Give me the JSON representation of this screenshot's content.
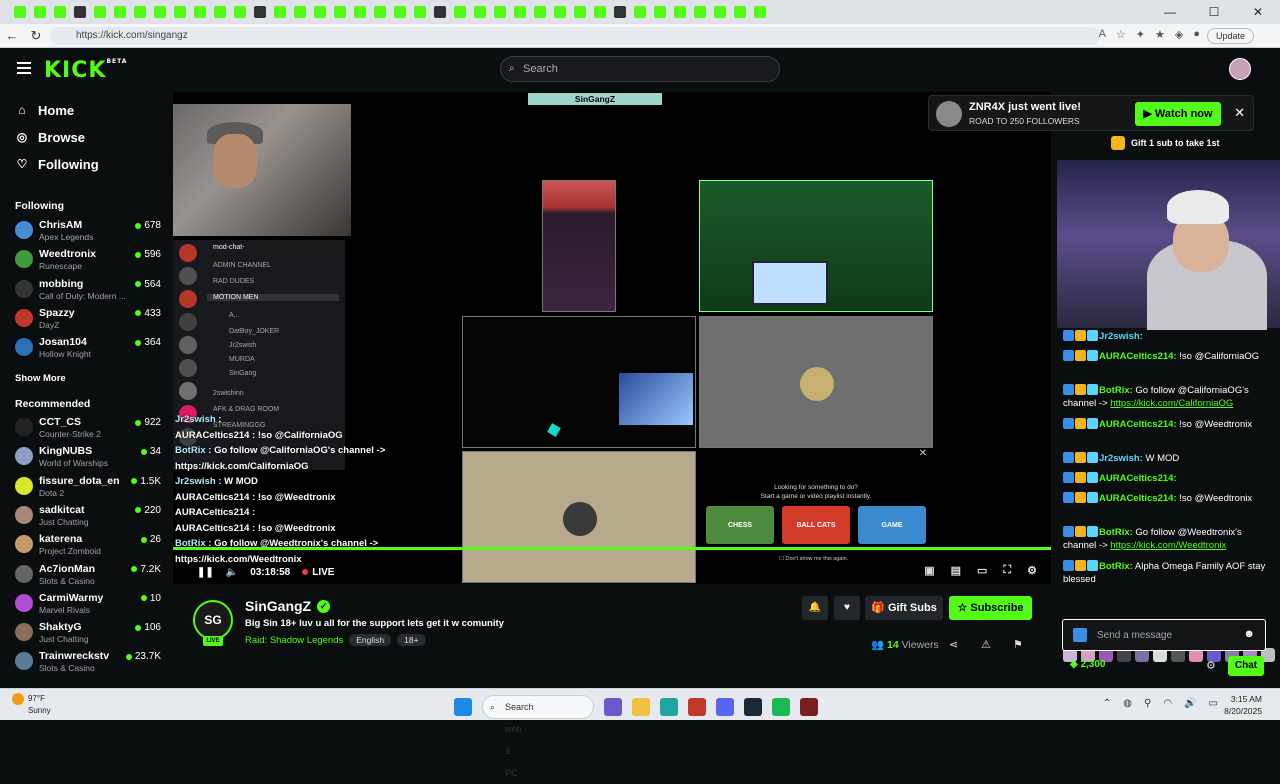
{
  "browser": {
    "url": "https://kick.com/singangz",
    "update_label": "Update"
  },
  "header": {
    "logo": "KICK",
    "logo_badge": "BETA",
    "search_placeholder": "Search"
  },
  "sidebar": {
    "nav": [
      {
        "label": "Home",
        "icon": "home-icon"
      },
      {
        "label": "Browse",
        "icon": "compass-icon"
      },
      {
        "label": "Following",
        "icon": "heart-icon"
      }
    ],
    "following_title": "Following",
    "following": [
      {
        "name": "ChrisAM",
        "game": "Apex Legends",
        "viewers": "678",
        "color": "#4a8bd6"
      },
      {
        "name": "Weedtronix",
        "game": "Runescape",
        "viewers": "596",
        "color": "#3d9a3d"
      },
      {
        "name": "mobbing",
        "game": "Call of Duty: Modern ...",
        "viewers": "564",
        "color": "#333333"
      },
      {
        "name": "Spazzy",
        "game": "DayZ",
        "viewers": "433",
        "color": "#c0392b"
      },
      {
        "name": "Josan104",
        "game": "Hollow Knight",
        "viewers": "364",
        "color": "#2c6fbb"
      }
    ],
    "show_more": "Show More",
    "recommended_title": "Recommended",
    "recommended": [
      {
        "name": "CCT_CS",
        "game": "Counter-Strike 2",
        "viewers": "922",
        "color": "#222222"
      },
      {
        "name": "KingNUBS",
        "game": "World of Warships",
        "viewers": "34",
        "color": "#8e9fc7"
      },
      {
        "name": "fissure_dota_en",
        "game": "Dota 2",
        "viewers": "1.5K",
        "color": "#d8e82b"
      },
      {
        "name": "sadkitcat",
        "game": "Just Chatting",
        "viewers": "220",
        "color": "#aa8877"
      },
      {
        "name": "katerena",
        "game": "Project Zomboid",
        "viewers": "26",
        "color": "#c49a6c"
      },
      {
        "name": "Ac7ionMan",
        "game": "Slots & Casino",
        "viewers": "7.2K",
        "color": "#666666"
      },
      {
        "name": "CarmiWarmy",
        "game": "Marvel Rivals",
        "viewers": "10",
        "color": "#b04bd6"
      },
      {
        "name": "ShaktyG",
        "game": "Just Chatting",
        "viewers": "106",
        "color": "#8a6d5a"
      },
      {
        "name": "Trainwreckstv",
        "game": "Slots & Casino",
        "viewers": "23.7K",
        "color": "#5a7a99"
      }
    ]
  },
  "player": {
    "banner": "SinGangZ",
    "discord": {
      "header": "mod-chat-",
      "lines": [
        "ADMIN CHANNEL",
        "RAD DUDES",
        "MOTION MEN",
        "A...",
        "DatBoy_JOKER",
        "Jr2swish",
        "MURDA",
        "SinGang",
        "2swishinn",
        "AFK & DRAG ROOM",
        "STREAMINGGG"
      ]
    },
    "overlay_chat": [
      {
        "user": "Jr2swish",
        "text": " :"
      },
      {
        "user": "",
        "text": "AURACeltics214 : !so @CaliforniaOG"
      },
      {
        "user": "BotRix",
        "text": " : Go follow @CaliforniaOG's channel ->"
      },
      {
        "user": "",
        "text": "https://kick.com/CaliforniaOG"
      },
      {
        "user": "Jr2swish",
        "text": " : W MOD"
      },
      {
        "user": "",
        "text": "AURACeltics214 : !so @Weedtronix"
      },
      {
        "user": "",
        "text": "AURACeltics214 :"
      },
      {
        "user": "",
        "text": "AURACeltics214 : !so @Weedtronix"
      },
      {
        "user": "BotRix",
        "text": " : Go follow @Weedtronix's channel ->"
      },
      {
        "user": "",
        "text": "https://kick.com/Weedtronix"
      }
    ],
    "recommend": {
      "line1": "Looking for something to do?",
      "line2": "Start a game or video playlist instantly.",
      "games": [
        "CHESS",
        "BALL CATS",
        "GAME"
      ],
      "dont_show": "Don't show me this again."
    },
    "time": "03:18:58",
    "live_label": "LIVE"
  },
  "toast": {
    "title": "ZNR4X just went live!",
    "subtitle": "ROAD TO 250 FOLLOWERS",
    "watch": "Watch now"
  },
  "chat": {
    "gift_text": "Gift 1 sub to take 1st",
    "messages": [
      {
        "user": "Jr2swish:",
        "color": "#5cd6ff",
        "text": "",
        "link": ""
      },
      {
        "user": "AURACeltics214:",
        "color": "#53fc18",
        "text": " !so @CaliforniaOG",
        "link": ""
      },
      {
        "user": "BotRix:",
        "color": "#53fc18",
        "text": " Go follow @CaliforniaOG's channel -> ",
        "link": "https://kick.com/CaliforniaOG"
      },
      {
        "user": "AURACeltics214:",
        "color": "#53fc18",
        "text": " !so @Weedtronix",
        "link": ""
      },
      {
        "user": "Jr2swish:",
        "color": "#5cd6ff",
        "text": " W MOD",
        "link": ""
      },
      {
        "user": "AURACeltics214:",
        "color": "#53fc18",
        "text": "",
        "link": ""
      },
      {
        "user": "AURACeltics214:",
        "color": "#53fc18",
        "text": " !so @Weedtronix",
        "link": ""
      },
      {
        "user": "BotRix:",
        "color": "#53fc18",
        "text": " Go follow @Weedtronix's channel -> ",
        "link": "https://kick.com/Weedtronix"
      },
      {
        "user": "BotRix:",
        "color": "#53fc18",
        "text": " Alpha Omega Family AOF stay blessed",
        "link": ""
      }
    ],
    "input_placeholder": "Send a message",
    "points": "2,300",
    "send_label": "Chat"
  },
  "stream_info": {
    "avatar_text": "SG",
    "live_badge": "LIVE",
    "name": "SinGangZ",
    "title": "Big Sin 18+ luv u all for the support lets get it w comunity",
    "category": "Raid: Shadow Legends",
    "tags": [
      "English",
      "18+"
    ],
    "gift_subs": "Gift Subs",
    "subscribe": "Subscribe",
    "viewers_count": "14",
    "viewers_label": " Viewers"
  },
  "taskbar": {
    "temp": "97°F",
    "condition": "Sunny",
    "search": "Search web & PC",
    "time": "3:15 AM",
    "date": "8/20/2025"
  }
}
